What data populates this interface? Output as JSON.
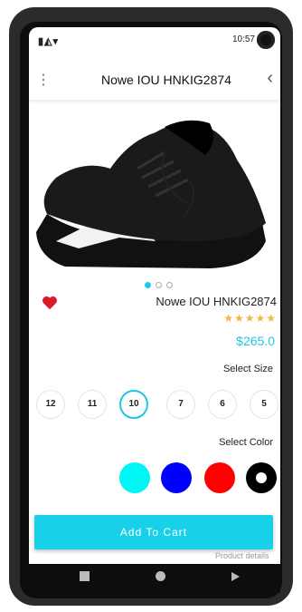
{
  "status": {
    "left_icons": "▮◭▾",
    "right_text": "10:57"
  },
  "appbar": {
    "title": "Nowe IOU HNKIG2874",
    "menu_icon": "more-vert-icon",
    "back_icon": "chevron-left-icon"
  },
  "product": {
    "name": "Nowe IOU HNKIG2874",
    "rating_stars": "★★★★★",
    "rating": 5,
    "price": "$265.0"
  },
  "carousel": {
    "total": 3,
    "active_index": 0
  },
  "size_section": {
    "label": "Select Size",
    "sizes": [
      "12",
      "11",
      "10",
      "7",
      "6",
      "5"
    ],
    "selected": "10"
  },
  "color_section": {
    "label": "Select Color",
    "colors": [
      "#00f5f5",
      "#0000ff",
      "#ff0000",
      "#000000"
    ]
  },
  "cart_button": {
    "label": "Add To Cart"
  },
  "footer_peek": {
    "text": "Product details"
  },
  "accent_color": "#18d1e8"
}
